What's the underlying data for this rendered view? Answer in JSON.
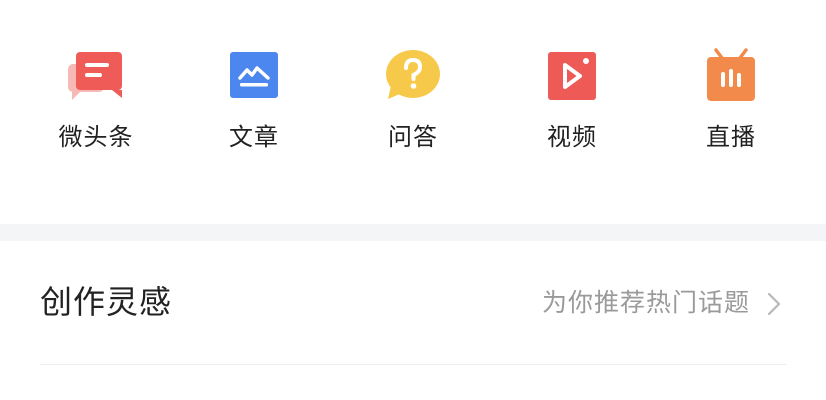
{
  "create_options": [
    {
      "label": "微头条",
      "icon": "micro-headline-icon",
      "color": "#ef5b57"
    },
    {
      "label": "文章",
      "icon": "article-icon",
      "color": "#4c87f0"
    },
    {
      "label": "问答",
      "icon": "qa-icon",
      "color": "#f7c94b"
    },
    {
      "label": "视频",
      "icon": "video-icon",
      "color": "#ee5a55"
    },
    {
      "label": "直播",
      "icon": "live-icon",
      "color": "#f28a4b"
    }
  ],
  "inspiration": {
    "title": "创作灵感",
    "subtitle": "为你推荐热门话题",
    "icon": "chevron-right-icon"
  }
}
